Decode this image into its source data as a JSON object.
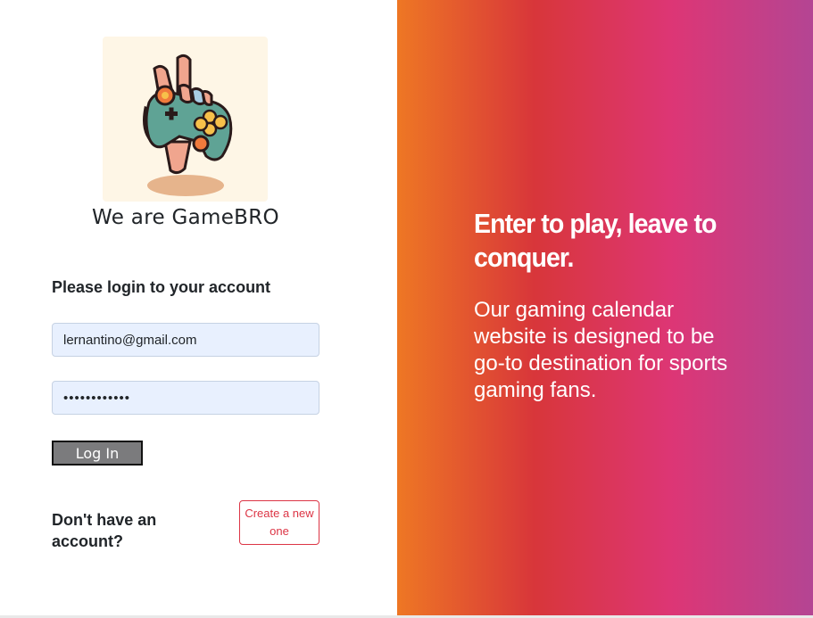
{
  "brand": {
    "title": "We are GameBRO",
    "logo_icon": "hand-gamepad-icon"
  },
  "login": {
    "heading": "Please login to your account",
    "email_value": "lernantino@gmail.com",
    "password_value": "••••••••••••",
    "submit_label": "Log In"
  },
  "signup": {
    "prompt": "Don't have an account?",
    "button_label": "Create a new one"
  },
  "promo": {
    "tagline": "Enter to play, leave to conquer.",
    "description": "Our gaming calendar website is designed to be go-to destination for sports gaming fans."
  },
  "colors": {
    "gradient": [
      "#ee7724",
      "#d8363a",
      "#dd3675",
      "#b44593"
    ],
    "accent_danger": "#dc3545",
    "input_bg": "#e8f0fe"
  }
}
